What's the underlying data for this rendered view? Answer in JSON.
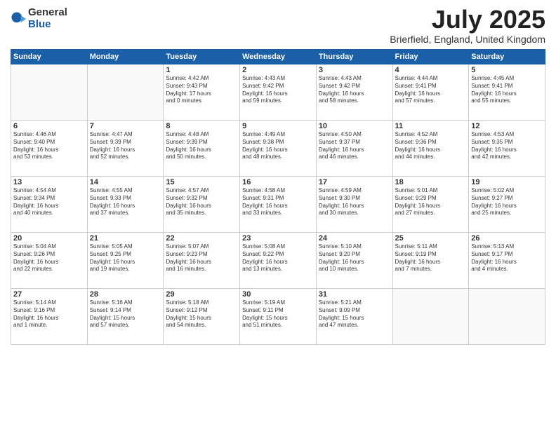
{
  "logo": {
    "general": "General",
    "blue": "Blue"
  },
  "title": "July 2025",
  "location": "Brierfield, England, United Kingdom",
  "weekdays": [
    "Sunday",
    "Monday",
    "Tuesday",
    "Wednesday",
    "Thursday",
    "Friday",
    "Saturday"
  ],
  "weeks": [
    [
      {
        "day": null
      },
      {
        "day": null
      },
      {
        "day": "1",
        "info": "Sunrise: 4:42 AM\nSunset: 9:43 PM\nDaylight: 17 hours\nand 0 minutes."
      },
      {
        "day": "2",
        "info": "Sunrise: 4:43 AM\nSunset: 9:42 PM\nDaylight: 16 hours\nand 59 minutes."
      },
      {
        "day": "3",
        "info": "Sunrise: 4:43 AM\nSunset: 9:42 PM\nDaylight: 16 hours\nand 58 minutes."
      },
      {
        "day": "4",
        "info": "Sunrise: 4:44 AM\nSunset: 9:41 PM\nDaylight: 16 hours\nand 57 minutes."
      },
      {
        "day": "5",
        "info": "Sunrise: 4:45 AM\nSunset: 9:41 PM\nDaylight: 16 hours\nand 55 minutes."
      }
    ],
    [
      {
        "day": "6",
        "info": "Sunrise: 4:46 AM\nSunset: 9:40 PM\nDaylight: 16 hours\nand 53 minutes."
      },
      {
        "day": "7",
        "info": "Sunrise: 4:47 AM\nSunset: 9:39 PM\nDaylight: 16 hours\nand 52 minutes."
      },
      {
        "day": "8",
        "info": "Sunrise: 4:48 AM\nSunset: 9:39 PM\nDaylight: 16 hours\nand 50 minutes."
      },
      {
        "day": "9",
        "info": "Sunrise: 4:49 AM\nSunset: 9:38 PM\nDaylight: 16 hours\nand 48 minutes."
      },
      {
        "day": "10",
        "info": "Sunrise: 4:50 AM\nSunset: 9:37 PM\nDaylight: 16 hours\nand 46 minutes."
      },
      {
        "day": "11",
        "info": "Sunrise: 4:52 AM\nSunset: 9:36 PM\nDaylight: 16 hours\nand 44 minutes."
      },
      {
        "day": "12",
        "info": "Sunrise: 4:53 AM\nSunset: 9:35 PM\nDaylight: 16 hours\nand 42 minutes."
      }
    ],
    [
      {
        "day": "13",
        "info": "Sunrise: 4:54 AM\nSunset: 9:34 PM\nDaylight: 16 hours\nand 40 minutes."
      },
      {
        "day": "14",
        "info": "Sunrise: 4:55 AM\nSunset: 9:33 PM\nDaylight: 16 hours\nand 37 minutes."
      },
      {
        "day": "15",
        "info": "Sunrise: 4:57 AM\nSunset: 9:32 PM\nDaylight: 16 hours\nand 35 minutes."
      },
      {
        "day": "16",
        "info": "Sunrise: 4:58 AM\nSunset: 9:31 PM\nDaylight: 16 hours\nand 33 minutes."
      },
      {
        "day": "17",
        "info": "Sunrise: 4:59 AM\nSunset: 9:30 PM\nDaylight: 16 hours\nand 30 minutes."
      },
      {
        "day": "18",
        "info": "Sunrise: 5:01 AM\nSunset: 9:29 PM\nDaylight: 16 hours\nand 27 minutes."
      },
      {
        "day": "19",
        "info": "Sunrise: 5:02 AM\nSunset: 9:27 PM\nDaylight: 16 hours\nand 25 minutes."
      }
    ],
    [
      {
        "day": "20",
        "info": "Sunrise: 5:04 AM\nSunset: 9:26 PM\nDaylight: 16 hours\nand 22 minutes."
      },
      {
        "day": "21",
        "info": "Sunrise: 5:05 AM\nSunset: 9:25 PM\nDaylight: 16 hours\nand 19 minutes."
      },
      {
        "day": "22",
        "info": "Sunrise: 5:07 AM\nSunset: 9:23 PM\nDaylight: 16 hours\nand 16 minutes."
      },
      {
        "day": "23",
        "info": "Sunrise: 5:08 AM\nSunset: 9:22 PM\nDaylight: 16 hours\nand 13 minutes."
      },
      {
        "day": "24",
        "info": "Sunrise: 5:10 AM\nSunset: 9:20 PM\nDaylight: 16 hours\nand 10 minutes."
      },
      {
        "day": "25",
        "info": "Sunrise: 5:11 AM\nSunset: 9:19 PM\nDaylight: 16 hours\nand 7 minutes."
      },
      {
        "day": "26",
        "info": "Sunrise: 5:13 AM\nSunset: 9:17 PM\nDaylight: 16 hours\nand 4 minutes."
      }
    ],
    [
      {
        "day": "27",
        "info": "Sunrise: 5:14 AM\nSunset: 9:16 PM\nDaylight: 16 hours\nand 1 minute."
      },
      {
        "day": "28",
        "info": "Sunrise: 5:16 AM\nSunset: 9:14 PM\nDaylight: 15 hours\nand 57 minutes."
      },
      {
        "day": "29",
        "info": "Sunrise: 5:18 AM\nSunset: 9:12 PM\nDaylight: 15 hours\nand 54 minutes."
      },
      {
        "day": "30",
        "info": "Sunrise: 5:19 AM\nSunset: 9:11 PM\nDaylight: 15 hours\nand 51 minutes."
      },
      {
        "day": "31",
        "info": "Sunrise: 5:21 AM\nSunset: 9:09 PM\nDaylight: 15 hours\nand 47 minutes."
      },
      {
        "day": null
      },
      {
        "day": null
      }
    ]
  ]
}
